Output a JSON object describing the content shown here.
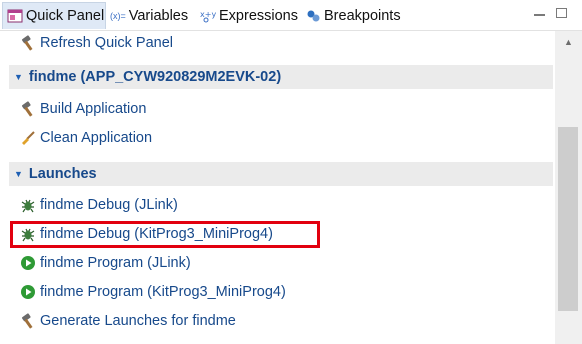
{
  "tabs": {
    "quick_panel": "Quick Panel",
    "variables": "Variables",
    "variables_icon_text": "(x)=",
    "expressions": "Expressions",
    "breakpoints": "Breakpoints"
  },
  "top_item": {
    "label": "Refresh Quick Panel",
    "icon": "hammer-icon"
  },
  "project_section": {
    "label": "findme (APP_CYW920829M2EVK-02)",
    "items": [
      {
        "label": "Build Application",
        "icon": "hammer-icon"
      },
      {
        "label": "Clean Application",
        "icon": "broom-icon"
      }
    ]
  },
  "launches_section": {
    "label": "Launches",
    "items": [
      {
        "label": "findme Debug (JLink)",
        "icon": "bug-icon"
      },
      {
        "label": "findme Debug (KitProg3_MiniProg4)",
        "icon": "bug-icon",
        "highlighted": true
      },
      {
        "label": "findme Program (JLink)",
        "icon": "play-icon"
      },
      {
        "label": "findme Program (KitProg3_MiniProg4)",
        "icon": "play-icon"
      },
      {
        "label": "Generate Launches for findme",
        "icon": "hammer-icon"
      }
    ]
  },
  "colors": {
    "link_blue": "#17498b",
    "section_bg": "#ebebeb",
    "highlight_red": "#e2000f",
    "play_green": "#2e9a35"
  }
}
